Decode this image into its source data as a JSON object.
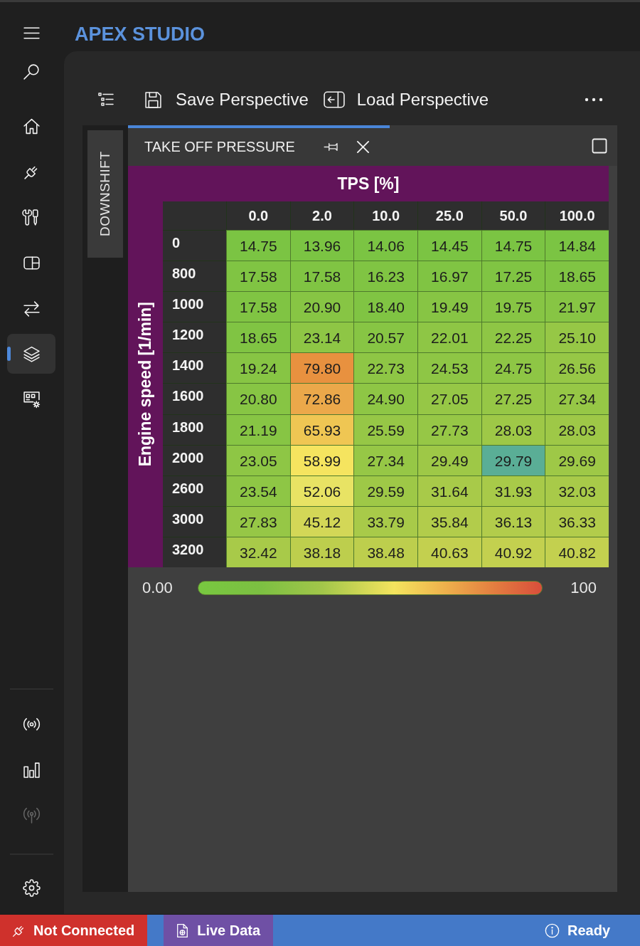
{
  "app": {
    "title": "APEX STUDIO"
  },
  "sidebar": {
    "top": [
      {
        "kind": "menu",
        "selected": false,
        "disabled": false
      },
      {
        "kind": "search",
        "selected": false,
        "disabled": false
      }
    ],
    "nav": [
      {
        "kind": "home",
        "selected": false,
        "disabled": false
      },
      {
        "kind": "plug",
        "selected": false,
        "disabled": false
      },
      {
        "kind": "tools",
        "selected": false,
        "disabled": false
      },
      {
        "kind": "panel",
        "selected": false,
        "disabled": false
      },
      {
        "kind": "swap",
        "selected": false,
        "disabled": false
      },
      {
        "kind": "layers",
        "selected": true,
        "disabled": false
      },
      {
        "kind": "dashboard",
        "selected": false,
        "disabled": false
      }
    ],
    "tools": [
      {
        "kind": "broadcast",
        "selected": false,
        "disabled": false
      },
      {
        "kind": "bar_chart",
        "selected": false,
        "disabled": false
      },
      {
        "kind": "antenna",
        "selected": false,
        "disabled": true
      }
    ],
    "footer": [
      {
        "kind": "settings",
        "selected": false,
        "disabled": false
      }
    ]
  },
  "toolbar": {
    "items": [
      {
        "kind": "outline"
      },
      {
        "kind": "save",
        "label": "Save Perspective"
      },
      {
        "kind": "load",
        "label": "Load Perspective"
      },
      {
        "kind": "more"
      }
    ]
  },
  "dock": {
    "side_tabs": [
      {
        "label": "DOWNSHIFT"
      }
    ],
    "tabs": [
      {
        "label": "TAKE OFF PRESSURE",
        "selected": true
      }
    ]
  },
  "table": {
    "title": "TPS [%]",
    "row_axis_title": "Engine speed [1/min]",
    "columns": [
      "0.0",
      "2.0",
      "10.0",
      "25.0",
      "50.0",
      "100.0"
    ],
    "rows": [
      {
        "label": "0",
        "cells": [
          {
            "value": "14.75",
            "color": "#7bc443"
          },
          {
            "value": "13.96",
            "color": "#7bc443"
          },
          {
            "value": "14.06",
            "color": "#7bc443"
          },
          {
            "value": "14.45",
            "color": "#7bc443"
          },
          {
            "value": "14.75",
            "color": "#7bc443"
          },
          {
            "value": "14.84",
            "color": "#7bc443"
          }
        ]
      },
      {
        "label": "800",
        "cells": [
          {
            "value": "17.58",
            "color": "#80c443"
          },
          {
            "value": "17.58",
            "color": "#80c443"
          },
          {
            "value": "16.23",
            "color": "#80c443"
          },
          {
            "value": "16.97",
            "color": "#80c443"
          },
          {
            "value": "17.25",
            "color": "#80c443"
          },
          {
            "value": "18.65",
            "color": "#80c443"
          }
        ]
      },
      {
        "label": "1000",
        "cells": [
          {
            "value": "17.58",
            "color": "#80c443"
          },
          {
            "value": "20.90",
            "color": "#87c544"
          },
          {
            "value": "18.40",
            "color": "#80c443"
          },
          {
            "value": "19.49",
            "color": "#87c544"
          },
          {
            "value": "19.75",
            "color": "#87c544"
          },
          {
            "value": "21.97",
            "color": "#87c544"
          }
        ]
      },
      {
        "label": "1200",
        "cells": [
          {
            "value": "18.65",
            "color": "#80c443"
          },
          {
            "value": "23.14",
            "color": "#8ec645"
          },
          {
            "value": "20.57",
            "color": "#87c544"
          },
          {
            "value": "22.01",
            "color": "#8ec645"
          },
          {
            "value": "22.25",
            "color": "#8ec645"
          },
          {
            "value": "25.10",
            "color": "#96c746"
          }
        ]
      },
      {
        "label": "1400",
        "cells": [
          {
            "value": "19.24",
            "color": "#87c544"
          },
          {
            "value": "79.80",
            "color": "#e8913f"
          },
          {
            "value": "22.73",
            "color": "#8ec645"
          },
          {
            "value": "24.53",
            "color": "#8ec645"
          },
          {
            "value": "24.75",
            "color": "#8ec645"
          },
          {
            "value": "26.56",
            "color": "#96c746"
          }
        ]
      },
      {
        "label": "1600",
        "cells": [
          {
            "value": "20.80",
            "color": "#87c544"
          },
          {
            "value": "72.86",
            "color": "#eba84a"
          },
          {
            "value": "24.90",
            "color": "#8ec645"
          },
          {
            "value": "27.05",
            "color": "#96c746"
          },
          {
            "value": "27.25",
            "color": "#96c746"
          },
          {
            "value": "27.34",
            "color": "#96c746"
          }
        ]
      },
      {
        "label": "1800",
        "cells": [
          {
            "value": "21.19",
            "color": "#87c544"
          },
          {
            "value": "65.93",
            "color": "#efc653"
          },
          {
            "value": "25.59",
            "color": "#96c746"
          },
          {
            "value": "27.73",
            "color": "#96c746"
          },
          {
            "value": "28.03",
            "color": "#9ec847"
          },
          {
            "value": "28.03",
            "color": "#9ec847"
          }
        ]
      },
      {
        "label": "2000",
        "cells": [
          {
            "value": "23.05",
            "color": "#8ec645"
          },
          {
            "value": "58.99",
            "color": "#f5e45f"
          },
          {
            "value": "27.34",
            "color": "#96c746"
          },
          {
            "value": "29.49",
            "color": "#9ec847"
          },
          {
            "value": "29.79",
            "color": "#5aae96"
          },
          {
            "value": "29.69",
            "color": "#9ec847"
          }
        ]
      },
      {
        "label": "2600",
        "cells": [
          {
            "value": "23.54",
            "color": "#8ec645"
          },
          {
            "value": "52.06",
            "color": "#e8e364"
          },
          {
            "value": "29.59",
            "color": "#9ec847"
          },
          {
            "value": "31.64",
            "color": "#a8ca49"
          },
          {
            "value": "31.93",
            "color": "#a8ca49"
          },
          {
            "value": "32.03",
            "color": "#a8ca49"
          }
        ]
      },
      {
        "label": "3000",
        "cells": [
          {
            "value": "27.83",
            "color": "#96c746"
          },
          {
            "value": "45.12",
            "color": "#d3d757"
          },
          {
            "value": "33.79",
            "color": "#a8ca49"
          },
          {
            "value": "35.84",
            "color": "#b2cc4b"
          },
          {
            "value": "36.13",
            "color": "#b2cc4b"
          },
          {
            "value": "36.33",
            "color": "#b2cc4b"
          }
        ]
      },
      {
        "label": "3200",
        "cells": [
          {
            "value": "32.42",
            "color": "#a8ca49"
          },
          {
            "value": "38.18",
            "color": "#bdce4d"
          },
          {
            "value": "38.48",
            "color": "#bdce4d"
          },
          {
            "value": "40.63",
            "color": "#c3d04f"
          },
          {
            "value": "40.92",
            "color": "#c3d04f"
          },
          {
            "value": "40.82",
            "color": "#c3d04f"
          }
        ]
      }
    ]
  },
  "legend": {
    "min": "0.00",
    "max": "100"
  },
  "status_bar": {
    "items": [
      {
        "kind": "connection",
        "label": "Not Connected",
        "color": "#cf312c"
      },
      {
        "kind": "live_data",
        "label": "Live Data",
        "color": "#6f50a5"
      }
    ],
    "message": "Ready"
  }
}
